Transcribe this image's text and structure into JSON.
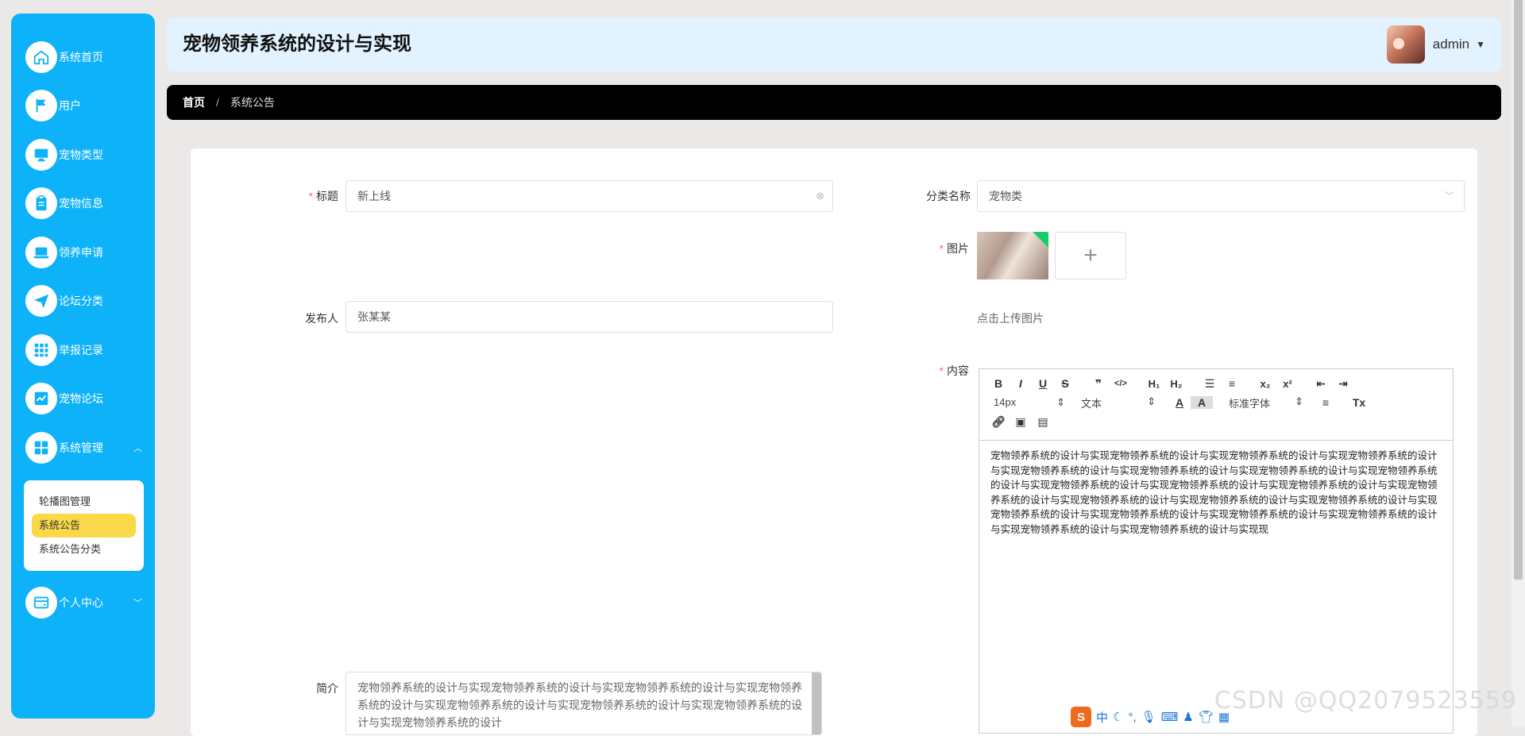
{
  "app": {
    "title": "宠物领养系统的设计与实现"
  },
  "user": {
    "name": "admin"
  },
  "sidebar": {
    "items": [
      {
        "label": "系统首页",
        "icon": "home-icon"
      },
      {
        "label": "用户",
        "icon": "flag-icon"
      },
      {
        "label": "宠物类型",
        "icon": "monitor-icon"
      },
      {
        "label": "宠物信息",
        "icon": "clipboard-icon"
      },
      {
        "label": "领养申请",
        "icon": "laptop-icon"
      },
      {
        "label": "论坛分类",
        "icon": "send-icon"
      },
      {
        "label": "举报记录",
        "icon": "grid-icon"
      },
      {
        "label": "宠物论坛",
        "icon": "chart-icon"
      },
      {
        "label": "系统管理",
        "icon": "apps-icon"
      }
    ],
    "submenu": [
      {
        "label": "轮播图管理"
      },
      {
        "label": "系统公告"
      },
      {
        "label": "系统公告分类"
      }
    ],
    "personal": {
      "label": "个人中心",
      "icon": "card-icon"
    }
  },
  "breadcrumb": {
    "home": "首页",
    "separator": "/",
    "current": "系统公告"
  },
  "form": {
    "title_label": "标题",
    "title_value": "新上线",
    "category_label": "分类名称",
    "category_value": "宠物类",
    "image_label": "图片",
    "upload_hint": "点击上传图片",
    "publisher_label": "发布人",
    "publisher_value": "张某某",
    "content_label": "内容",
    "intro_label": "简介",
    "intro_value": "宠物领养系统的设计与实现宠物领养系统的设计与实现宠物领养系统的设计与实现宠物领养系统的设计与实现宠物领养系统的设计与实现宠物领养系统的设计与实现宠物领养系统的设计与实现宠物领养系统的设计"
  },
  "editor": {
    "font_size": "14px",
    "text_type": "文本",
    "font_family": "标准字体",
    "content": "宠物领养系统的设计与实现宠物领养系统的设计与实现宠物领养系统的设计与实现宠物领养系统的设计与实现宠物领养系统的设计与实现宠物领养系统的设计与实现宠物领养系统的设计与实现宠物领养系统的设计与实现宠物领养系统的设计与实现宠物领养系统的设计与实现宠物领养系统的设计与实现宠物领养系统的设计与实现宠物领养系统的设计与实现宠物领养系统的设计与实现宠物领养系统的设计与实现宠物领养系统的设计与实现宠物领养系统的设计与实现宠物领养系统的设计与实现宠物领养系统的设计与实现宠物领养系统的设计与实现宠物领养系统的设计与实现现"
  },
  "watermark": "CSDN @QQ2079523559",
  "ime": {
    "label": "中"
  },
  "colors": {
    "sidebar": "#0db2f9",
    "header": "#e2f2fe",
    "breadcrumb": "#000000",
    "active_submenu": "#f9d84a",
    "required": "#f56c6c"
  }
}
